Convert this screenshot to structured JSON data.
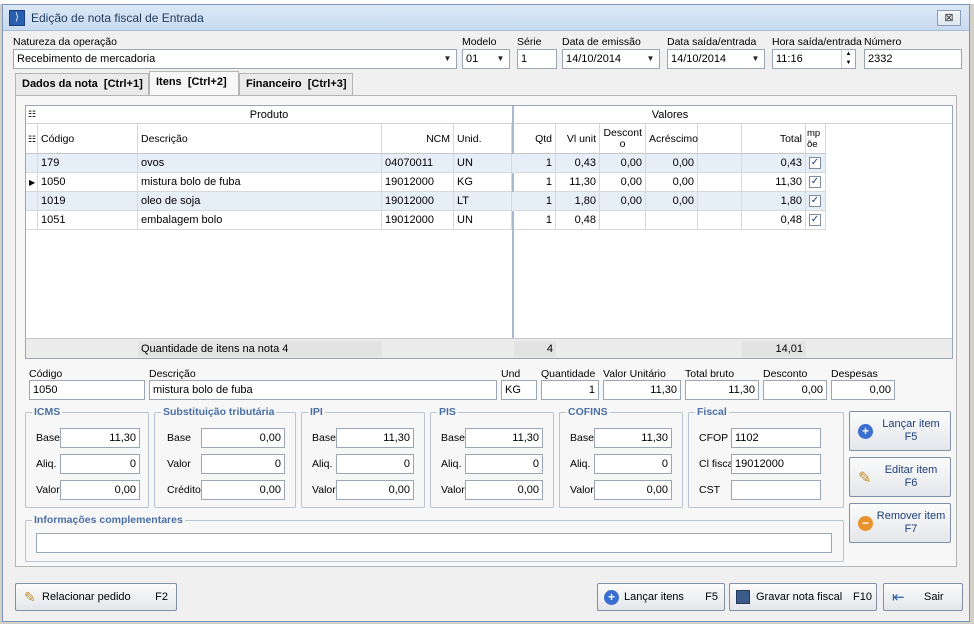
{
  "window": {
    "title": "Edição de nota fiscal de Entrada",
    "close_label": "⊠"
  },
  "header": {
    "natureza_label": "Natureza da operação",
    "natureza_value": "Recebimento de mercadoria",
    "modelo_label": "Modelo",
    "modelo_value": "01",
    "serie_label": "Série",
    "serie_value": "1",
    "emissao_label": "Data de emissão",
    "emissao_value": "14/10/2014",
    "saida_label": "Data saída/entrada",
    "saida_value": "14/10/2014",
    "hora_label": "Hora saída/entrada",
    "hora_value": "11:16",
    "numero_label": "Número",
    "numero_value": "2332"
  },
  "tabs": [
    {
      "label": "Dados da nota",
      "shortcut": "[Ctrl+1]"
    },
    {
      "label": "Itens",
      "shortcut": "[Ctrl+2]"
    },
    {
      "label": "Financeiro",
      "shortcut": "[Ctrl+3]"
    }
  ],
  "grid": {
    "group_produto": "Produto",
    "group_valores": "Valores",
    "columns": {
      "codigo": "Código",
      "descricao": "Descrição",
      "ncm": "NCM",
      "unid": "Unid.",
      "qtd": "Qtd",
      "vlunit": "Vl unit",
      "desconto_top": "Descont",
      "desconto_bot": "o",
      "acrescimo": "Acréscimo",
      "total": "Total",
      "imp_top": "mp",
      "imp_bot": "õe"
    },
    "rows": [
      {
        "codigo": "179",
        "descricao": "ovos",
        "ncm": "04070011",
        "unid": "UN",
        "qtd": "1",
        "vlunit": "0,43",
        "desconto": "0,00",
        "acrescimo": "0,00",
        "total": "0,43",
        "check": "✓",
        "selected": false
      },
      {
        "codigo": "1050",
        "descricao": "mistura bolo de fuba",
        "ncm": "19012000",
        "unid": "KG",
        "qtd": "1",
        "vlunit": "11,30",
        "desconto": "0,00",
        "acrescimo": "0,00",
        "total": "11,30",
        "check": "✓",
        "selected": true
      },
      {
        "codigo": "1019",
        "descricao": "oleo de soja",
        "ncm": "19012000",
        "unid": "LT",
        "qtd": "1",
        "vlunit": "1,80",
        "desconto": "0,00",
        "acrescimo": "0,00",
        "total": "1,80",
        "check": "✓",
        "selected": false
      },
      {
        "codigo": "1051",
        "descricao": "embalagem bolo",
        "ncm": "19012000",
        "unid": "UN",
        "qtd": "1",
        "vlunit": "0,48",
        "desconto": "",
        "acrescimo": "",
        "total": "0,48",
        "check": "✓",
        "selected": false
      }
    ],
    "footer": {
      "label": "Quantidade de itens na nota 4",
      "qtd_total": "4",
      "valor_total": "14,01"
    }
  },
  "item": {
    "codigo_label": "Código",
    "codigo_value": "1050",
    "descricao_label": "Descrição",
    "descricao_value": "mistura bolo de fuba",
    "und_label": "Und",
    "und_value": "KG",
    "quantidade_label": "Quantidade",
    "quantidade_value": "1",
    "valor_unitario_label": "Valor Unitário",
    "valor_unitario_value": "11,30",
    "total_bruto_label": "Total bruto",
    "total_bruto_value": "11,30",
    "desconto_label": "Desconto",
    "desconto_value": "0,00",
    "despesas_label": "Despesas",
    "despesas_value": "0,00"
  },
  "taxes": {
    "icms": {
      "title": "ICMS",
      "base_label": "Base",
      "base": "11,30",
      "aliq_label": "Aliq.",
      "aliq": "0",
      "valor_label": "Valor",
      "valor": "0,00"
    },
    "st": {
      "title": "Substituição tributária",
      "base_label": "Base",
      "base": "0,00",
      "valor_label": "Valor",
      "valor": "0",
      "credito_label": "Crédito",
      "credito": "0,00"
    },
    "ipi": {
      "title": "IPI",
      "base_label": "Base",
      "base": "11,30",
      "aliq_label": "Aliq.",
      "aliq": "0",
      "valor_label": "Valor",
      "valor": "0,00"
    },
    "pis": {
      "title": "PIS",
      "base_label": "Base",
      "base": "11,30",
      "aliq_label": "Aliq.",
      "aliq": "0",
      "valor_label": "Valor",
      "valor": "0,00"
    },
    "cofins": {
      "title": "COFINS",
      "base_label": "Base",
      "base": "11,30",
      "aliq_label": "Aliq.",
      "aliq": "0",
      "valor_label": "Valor",
      "valor": "0,00"
    },
    "fiscal": {
      "title": "Fiscal",
      "cfop_label": "CFOP",
      "cfop": "1102",
      "clfiscal_label": "Cl fiscal",
      "clfiscal": "19012000",
      "cst_label": "CST",
      "cst": ""
    }
  },
  "complementares": {
    "title": "Informações complementares",
    "value": ""
  },
  "side_buttons": {
    "lancar_item": {
      "line1": "Lançar item",
      "line2": "F5"
    },
    "editar_item": {
      "line1": "Editar item",
      "line2": "F6"
    },
    "remover_item": {
      "line1": "Remover item",
      "line2": "F7"
    }
  },
  "bottom_buttons": {
    "relacionar": {
      "label": "Relacionar pedido",
      "key": "F2"
    },
    "lancar_itens": {
      "label": "Lançar itens",
      "key": "F5"
    },
    "gravar": {
      "label": "Gravar nota fiscal",
      "key": "F10"
    },
    "sair": {
      "label": "Sair"
    }
  },
  "colors": {
    "accent": "#4a6fa5",
    "selected_row": "#e6eef8",
    "window_border": "#7a96b8"
  }
}
